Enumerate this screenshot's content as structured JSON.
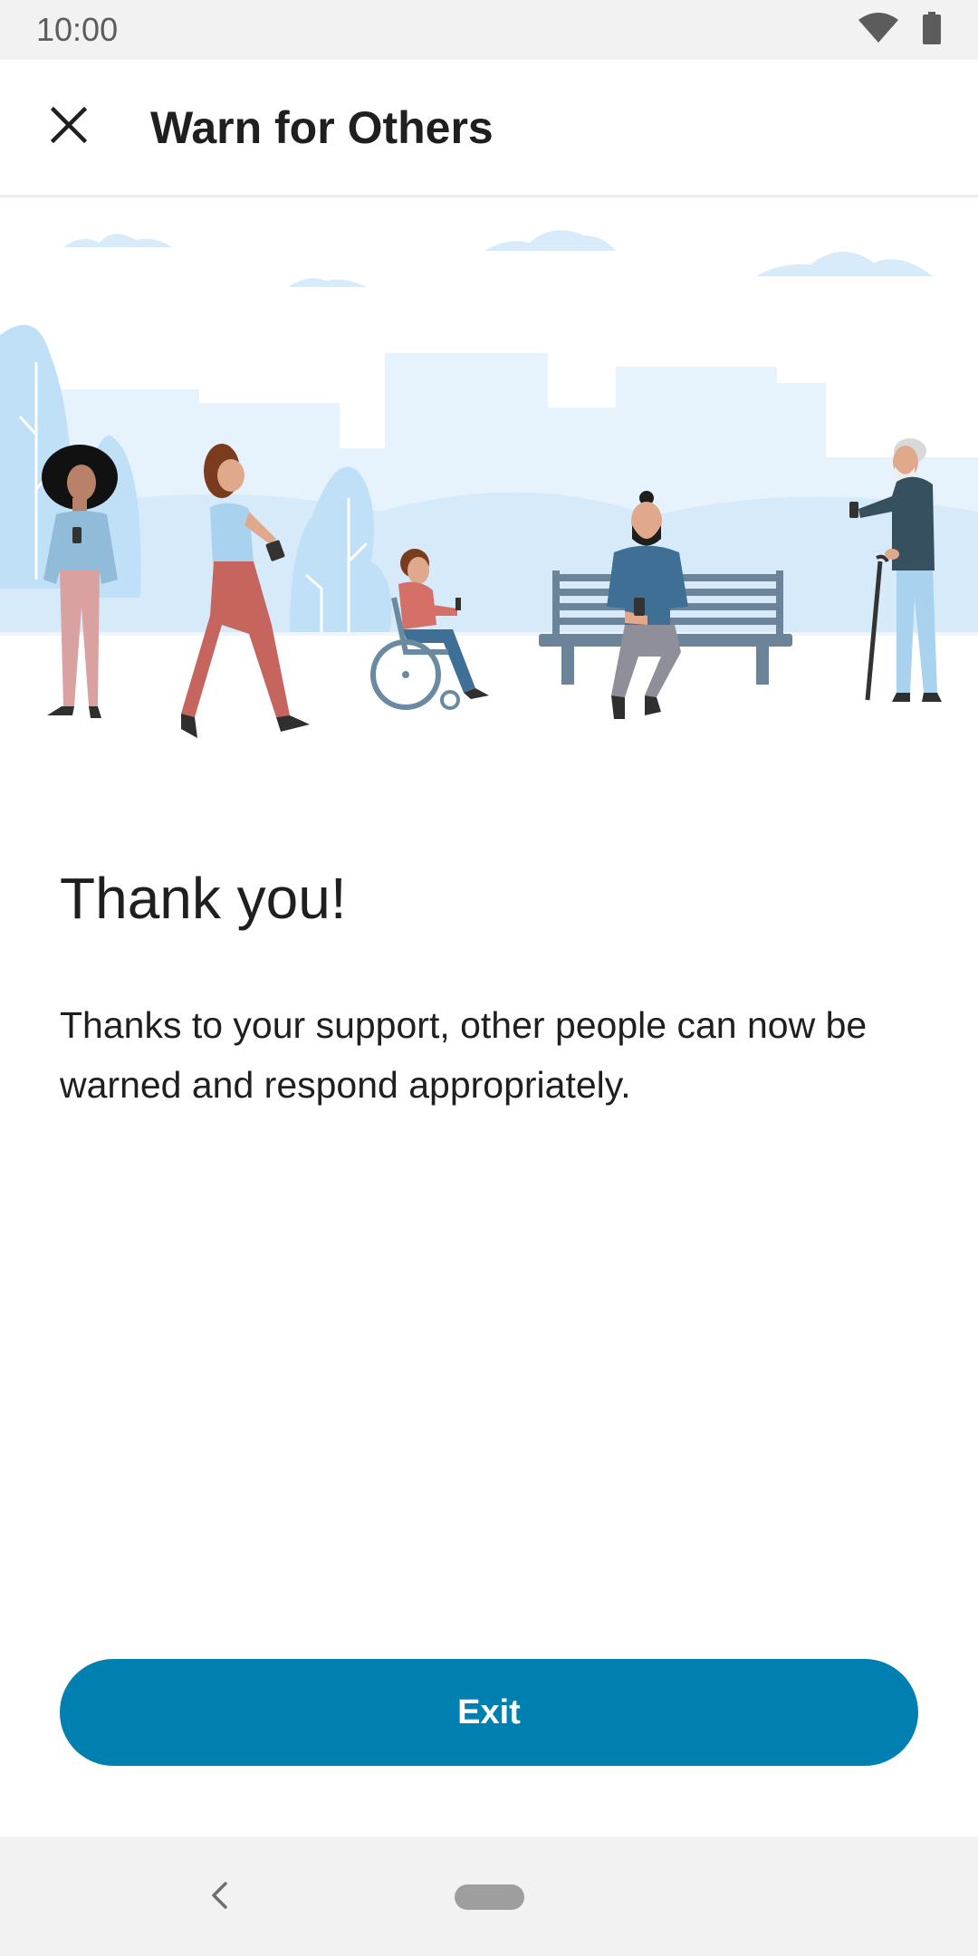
{
  "status_bar": {
    "time": "10:00",
    "icons": [
      "wifi-icon",
      "battery-icon"
    ]
  },
  "app_bar": {
    "title": "Warn for Others",
    "close_icon": "close-icon"
  },
  "illustration": {
    "description_icon": "people-in-park-illustration"
  },
  "content": {
    "heading": "Thank you!",
    "body": "Thanks to your support, other people can now be warned and respond appropriately."
  },
  "actions": {
    "exit_label": "Exit"
  },
  "nav_bar": {
    "icons": [
      "back-icon",
      "home-pill-icon"
    ]
  },
  "colors": {
    "primary": "#0080b0",
    "status_bar_bg": "#f2f2f2",
    "illustration_sky": "#e6f3fc",
    "tree": "#bfe0f7"
  }
}
